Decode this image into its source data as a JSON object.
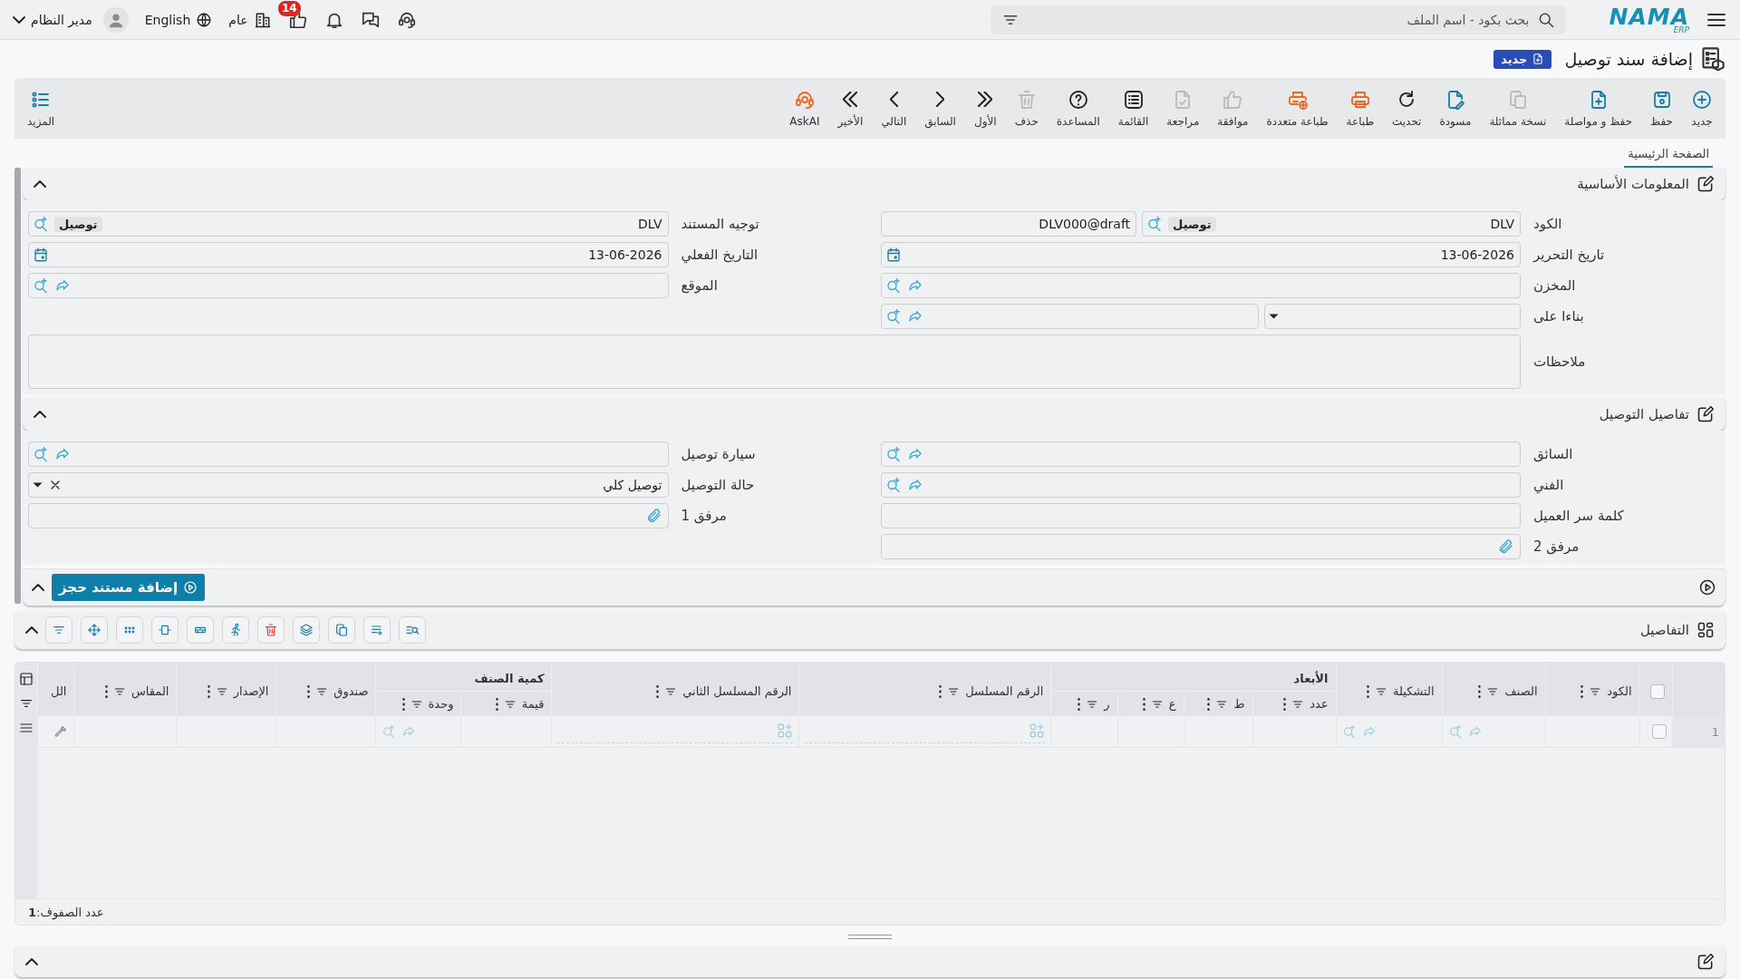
{
  "topbar": {
    "logo": "NAMA",
    "logo_sub": "ERP",
    "search": {
      "placeholder": "بحث بكود - اسم الملف"
    },
    "notifications": "14",
    "branch": "عام",
    "language": "English",
    "user": "مدير النظام"
  },
  "page": {
    "title": "إضافة سند توصيل",
    "status": "جديد"
  },
  "toolbar": [
    {
      "label": "جديد",
      "kind": "new",
      "disabled": false
    },
    {
      "label": "حفظ",
      "kind": "save",
      "disabled": false
    },
    {
      "label": "حفظ و مواصلة",
      "kind": "save-continue",
      "disabled": false
    },
    {
      "label": "نسخة مماثلة",
      "kind": "duplicate",
      "disabled": true
    },
    {
      "label": "مسودة",
      "kind": "draft",
      "disabled": false
    },
    {
      "label": "تحديث",
      "kind": "refresh",
      "disabled": false
    },
    {
      "label": "طباعة",
      "kind": "print",
      "disabled": false
    },
    {
      "label": "طباعة متعددة",
      "kind": "multi-print",
      "disabled": false
    },
    {
      "label": "موافقة",
      "kind": "approve",
      "disabled": true
    },
    {
      "label": "مراجعة",
      "kind": "review",
      "disabled": true
    },
    {
      "label": "القائمة",
      "kind": "list",
      "disabled": false
    },
    {
      "label": "المساعدة",
      "kind": "help",
      "disabled": false
    },
    {
      "label": "حذف",
      "kind": "delete",
      "disabled": true
    },
    {
      "label": "الأول",
      "kind": "first",
      "disabled": false
    },
    {
      "label": "السابق",
      "kind": "previous",
      "disabled": false
    },
    {
      "label": "التالي",
      "kind": "next",
      "disabled": false
    },
    {
      "label": "الأخير",
      "kind": "last",
      "disabled": false
    },
    {
      "label": "AskAI",
      "kind": "askai",
      "disabled": false
    }
  ],
  "more": {
    "label": "المزيد"
  },
  "tabs": [
    {
      "label": "الصفحة الرئيسية",
      "selected": true
    }
  ],
  "sections": [
    {
      "title": "المعلومات الأساسية",
      "expanded": true,
      "columns": [
        [
          {
            "label": "الكود",
            "kind": "code",
            "value": "DLV",
            "tag": "توصيل",
            "number": "DLV000@draft"
          },
          {
            "label": "تاريخ التحرير",
            "kind": "date",
            "value": "13-06-2026"
          },
          {
            "label": "المخزن",
            "kind": "reference"
          },
          {
            "label": "بناءا على",
            "kind": "based-on"
          }
        ],
        [
          {
            "label": "توجيه المستند",
            "kind": "tagged",
            "value": "DLV",
            "tag": "توصيل"
          },
          {
            "label": "التاريخ الفعلي",
            "kind": "date",
            "value": "13-06-2026"
          },
          {
            "label": "الموقع",
            "kind": "reference"
          }
        ]
      ],
      "wide_fields": [
        {
          "label": "ملاحظات",
          "kind": "textarea"
        }
      ]
    },
    {
      "title": "تفاصيل التوصيل",
      "expanded": true,
      "columns": [
        [
          {
            "label": "السائق",
            "kind": "reference"
          },
          {
            "label": "الفني",
            "kind": "reference"
          },
          {
            "label": "كلمة سر العميل",
            "kind": "text"
          },
          {
            "label": "مرفق 2",
            "kind": "attachment"
          }
        ],
        [
          {
            "label": "سيارة توصيل",
            "kind": "reference"
          },
          {
            "label": "حالة التوصيل",
            "kind": "select",
            "value": "توصيل كلي"
          },
          {
            "label": "مرفق 1",
            "kind": "attachment"
          }
        ]
      ]
    }
  ],
  "actions": {
    "button": "إضافة مستند حجز",
    "expanded": true
  },
  "details": {
    "title": "التفاصيل",
    "expanded": true,
    "all_checked": false,
    "columns": [
      {
        "label": "الكود",
        "kind": "plain"
      },
      {
        "label": "الصنف",
        "kind": "lookup"
      },
      {
        "label": "التشكيلة",
        "kind": "lookup"
      },
      {
        "group": "الأبعاد",
        "children": [
          {
            "label": "عدد",
            "kind": "plain"
          },
          {
            "label": "ط",
            "kind": "plain"
          },
          {
            "label": "ع",
            "kind": "plain"
          },
          {
            "label": "ر",
            "kind": "plain"
          }
        ]
      },
      {
        "label": "الرقم المسلسل",
        "kind": "serial"
      },
      {
        "label": "الرقم المسلسل الثاني",
        "kind": "serial"
      },
      {
        "group": "كمية الصنف",
        "children": [
          {
            "label": "قيمة",
            "kind": "plain"
          },
          {
            "label": "وحدة",
            "kind": "lookup"
          }
        ]
      },
      {
        "label": "صندوق",
        "kind": "plain"
      },
      {
        "label": "الإصدار",
        "kind": "plain"
      },
      {
        "label": "المقاس",
        "kind": "plain"
      },
      {
        "label": "الل",
        "kind": "edit"
      }
    ],
    "rows": [
      {
        "number": "1",
        "checked": false
      }
    ],
    "row_count": "عدد الصفوف:**1**"
  }
}
